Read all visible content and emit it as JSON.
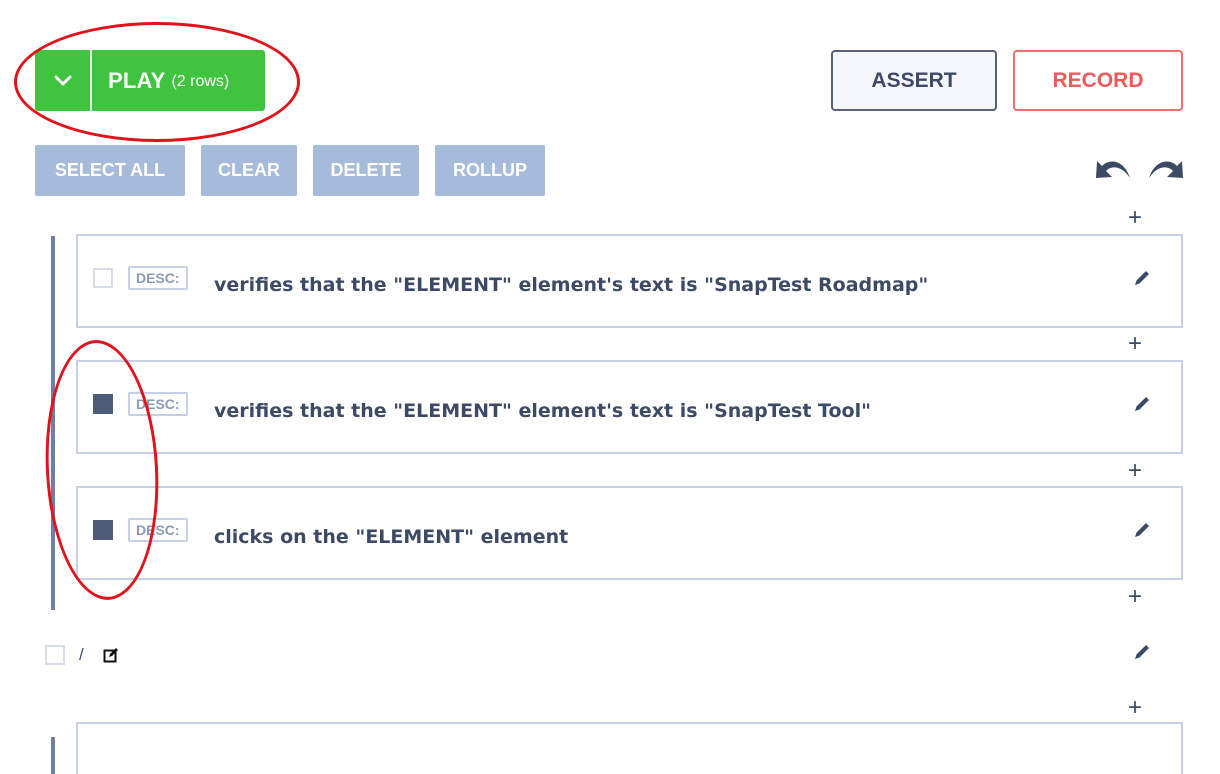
{
  "header": {
    "play": {
      "label": "PLAY",
      "count": "(2 rows)",
      "toggle_icon": "chevron-down-icon",
      "color": "#3ec43e"
    },
    "assert_label": "ASSERT",
    "record_label": "RECORD",
    "record_color": "#f05a5a"
  },
  "toolbar": {
    "select_all": "SELECT ALL",
    "clear": "CLEAR",
    "delete": "DELETE",
    "rollup": "ROLLUP",
    "undo_icon": "undo-icon",
    "redo_icon": "redo-icon"
  },
  "rows": [
    {
      "checked": false,
      "badge": "DESC:",
      "text": "verifies that the \"ELEMENT\" element's text is \"SnapTest Roadmap\""
    },
    {
      "checked": true,
      "badge": "DESC:",
      "text": "verifies that the \"ELEMENT\" element's text is \"SnapTest Tool\""
    },
    {
      "checked": true,
      "badge": "DESC:",
      "text": "clicks on the \"ELEMENT\" element"
    }
  ],
  "component_row": {
    "checked": false,
    "path": "/",
    "icon": "edit-icon"
  },
  "add_symbol": "+",
  "accent_colors": {
    "selected_checkbox": "#4f5c79",
    "toolbar_button": "#a6bbd9",
    "highlight": "#e0121b"
  }
}
